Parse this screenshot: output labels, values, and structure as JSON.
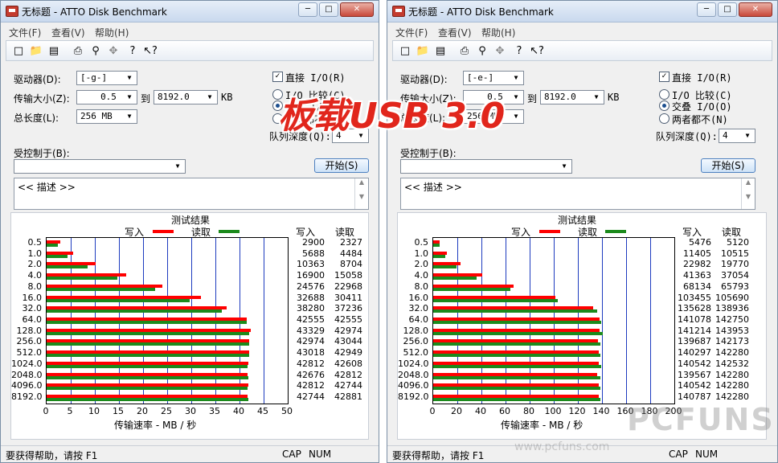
{
  "overlay": {
    "title": "板载USB 3.0",
    "watermark_brand": "PCFUNS",
    "watermark_url": "www.pcfuns.com"
  },
  "windows": [
    {
      "id": "left",
      "title": "无标题 - ATTO Disk Benchmark",
      "menu": [
        "文件(F)",
        "查看(V)",
        "帮助(H)"
      ],
      "window_buttons": {
        "minimize": "─",
        "maximize": "□",
        "close": "✕"
      },
      "form": {
        "drive_label": "驱动器(D):",
        "drive_value": "[-g-]",
        "transfer_label": "传输大小(Z):",
        "transfer_from": "0.5",
        "to_label": "到",
        "transfer_to": "8192.0",
        "kb_label": "KB",
        "total_label": "总长度(L):",
        "total_value": "256 MB",
        "direct_io_label": "直接 I/O(R)",
        "direct_io_checked": true,
        "io_compare_label": "I/O 比较(C)",
        "overlap_io_label": "交叠 I/O(O)",
        "neither_label": "两者都不(N)",
        "selected_mode": "overlap",
        "queue_label": "队列深度(Q):",
        "queue_value": "4",
        "controlled_label": "受控制于(B):",
        "controlled_value": "",
        "start_label": "开始(S)",
        "desc_text": "<< 描述 >>"
      },
      "results": {
        "title": "测试结果",
        "legend_write": "写入",
        "legend_read": "读取",
        "col_write": "写入",
        "col_read": "读取",
        "xlabel": "传输速率 - MB / 秒",
        "status_help": "要获得帮助，请按 F1",
        "status_cap": "CAP",
        "status_num": "NUM"
      },
      "chart_data": {
        "type": "bar",
        "orientation": "horizontal",
        "categories": [
          "0.5",
          "1.0",
          "2.0",
          "4.0",
          "8.0",
          "16.0",
          "32.0",
          "64.0",
          "128.0",
          "256.0",
          "512.0",
          "1024.0",
          "2048.0",
          "4096.0",
          "8192.0"
        ],
        "series": [
          {
            "name": "写入",
            "color": "#ff0000",
            "values": [
              2900,
              5688,
              10363,
              16900,
              24576,
              32688,
              38280,
              42555,
              43329,
              42974,
              43018,
              42812,
              42676,
              42812,
              42744
            ]
          },
          {
            "name": "读取",
            "color": "#1c8a1c",
            "values": [
              2327,
              4484,
              8704,
              15058,
              22968,
              30411,
              37236,
              42555,
              42974,
              43044,
              42949,
              42608,
              42812,
              42744,
              42881
            ]
          }
        ],
        "value_unit": "KB/s",
        "xlabel": "传输速率 - MB / 秒",
        "xlim": [
          0,
          50
        ],
        "xticks": [
          "0",
          "5",
          "10",
          "15",
          "20",
          "25",
          "30",
          "35",
          "40",
          "45",
          "50"
        ],
        "grid": true
      }
    },
    {
      "id": "right",
      "title": "无标题 - ATTO Disk Benchmark",
      "menu": [
        "文件(F)",
        "查看(V)",
        "帮助(H)"
      ],
      "window_buttons": {
        "minimize": "─",
        "maximize": "□",
        "close": "✕"
      },
      "form": {
        "drive_label": "驱动器(D):",
        "drive_value": "[-e-]",
        "transfer_label": "传输大小(Z):",
        "transfer_from": "0.5",
        "to_label": "到",
        "transfer_to": "8192.0",
        "kb_label": "KB",
        "total_label": "总长度(L):",
        "total_value": "256 MB",
        "direct_io_label": "直接 I/O(R)",
        "direct_io_checked": true,
        "io_compare_label": "I/O 比较(C)",
        "overlap_io_label": "交叠 I/O(O)",
        "neither_label": "两者都不(N)",
        "selected_mode": "overlap",
        "queue_label": "队列深度(Q):",
        "queue_value": "4",
        "controlled_label": "受控制于(B):",
        "controlled_value": "",
        "start_label": "开始(S)",
        "desc_text": "<< 描述 >>"
      },
      "results": {
        "title": "测试结果",
        "legend_write": "写入",
        "legend_read": "读取",
        "col_write": "写入",
        "col_read": "读取",
        "xlabel": "传输速率 - MB / 秒",
        "status_help": "要获得帮助，请按 F1",
        "status_cap": "CAP",
        "status_num": "NUM"
      },
      "chart_data": {
        "type": "bar",
        "orientation": "horizontal",
        "categories": [
          "0.5",
          "1.0",
          "2.0",
          "4.0",
          "8.0",
          "16.0",
          "32.0",
          "64.0",
          "128.0",
          "256.0",
          "512.0",
          "1024.0",
          "2048.0",
          "4096.0",
          "8192.0"
        ],
        "series": [
          {
            "name": "写入",
            "color": "#ff0000",
            "values": [
              5476,
              11405,
              22982,
              41363,
              68134,
              103455,
              135628,
              141078,
              141214,
              139687,
              140297,
              140542,
              139567,
              140542,
              140787
            ]
          },
          {
            "name": "读取",
            "color": "#1c8a1c",
            "values": [
              5120,
              10515,
              19770,
              37054,
              65793,
              105690,
              138936,
              142750,
              143953,
              142173,
              142280,
              142532,
              142280,
              142280,
              142280
            ]
          }
        ],
        "value_unit": "KB/s",
        "xlabel": "传输速率 - MB / 秒",
        "xlim": [
          0,
          200
        ],
        "xticks": [
          "0",
          "20",
          "40",
          "60",
          "80",
          "100",
          "120",
          "140",
          "160",
          "180",
          "200"
        ],
        "grid": true
      }
    }
  ]
}
